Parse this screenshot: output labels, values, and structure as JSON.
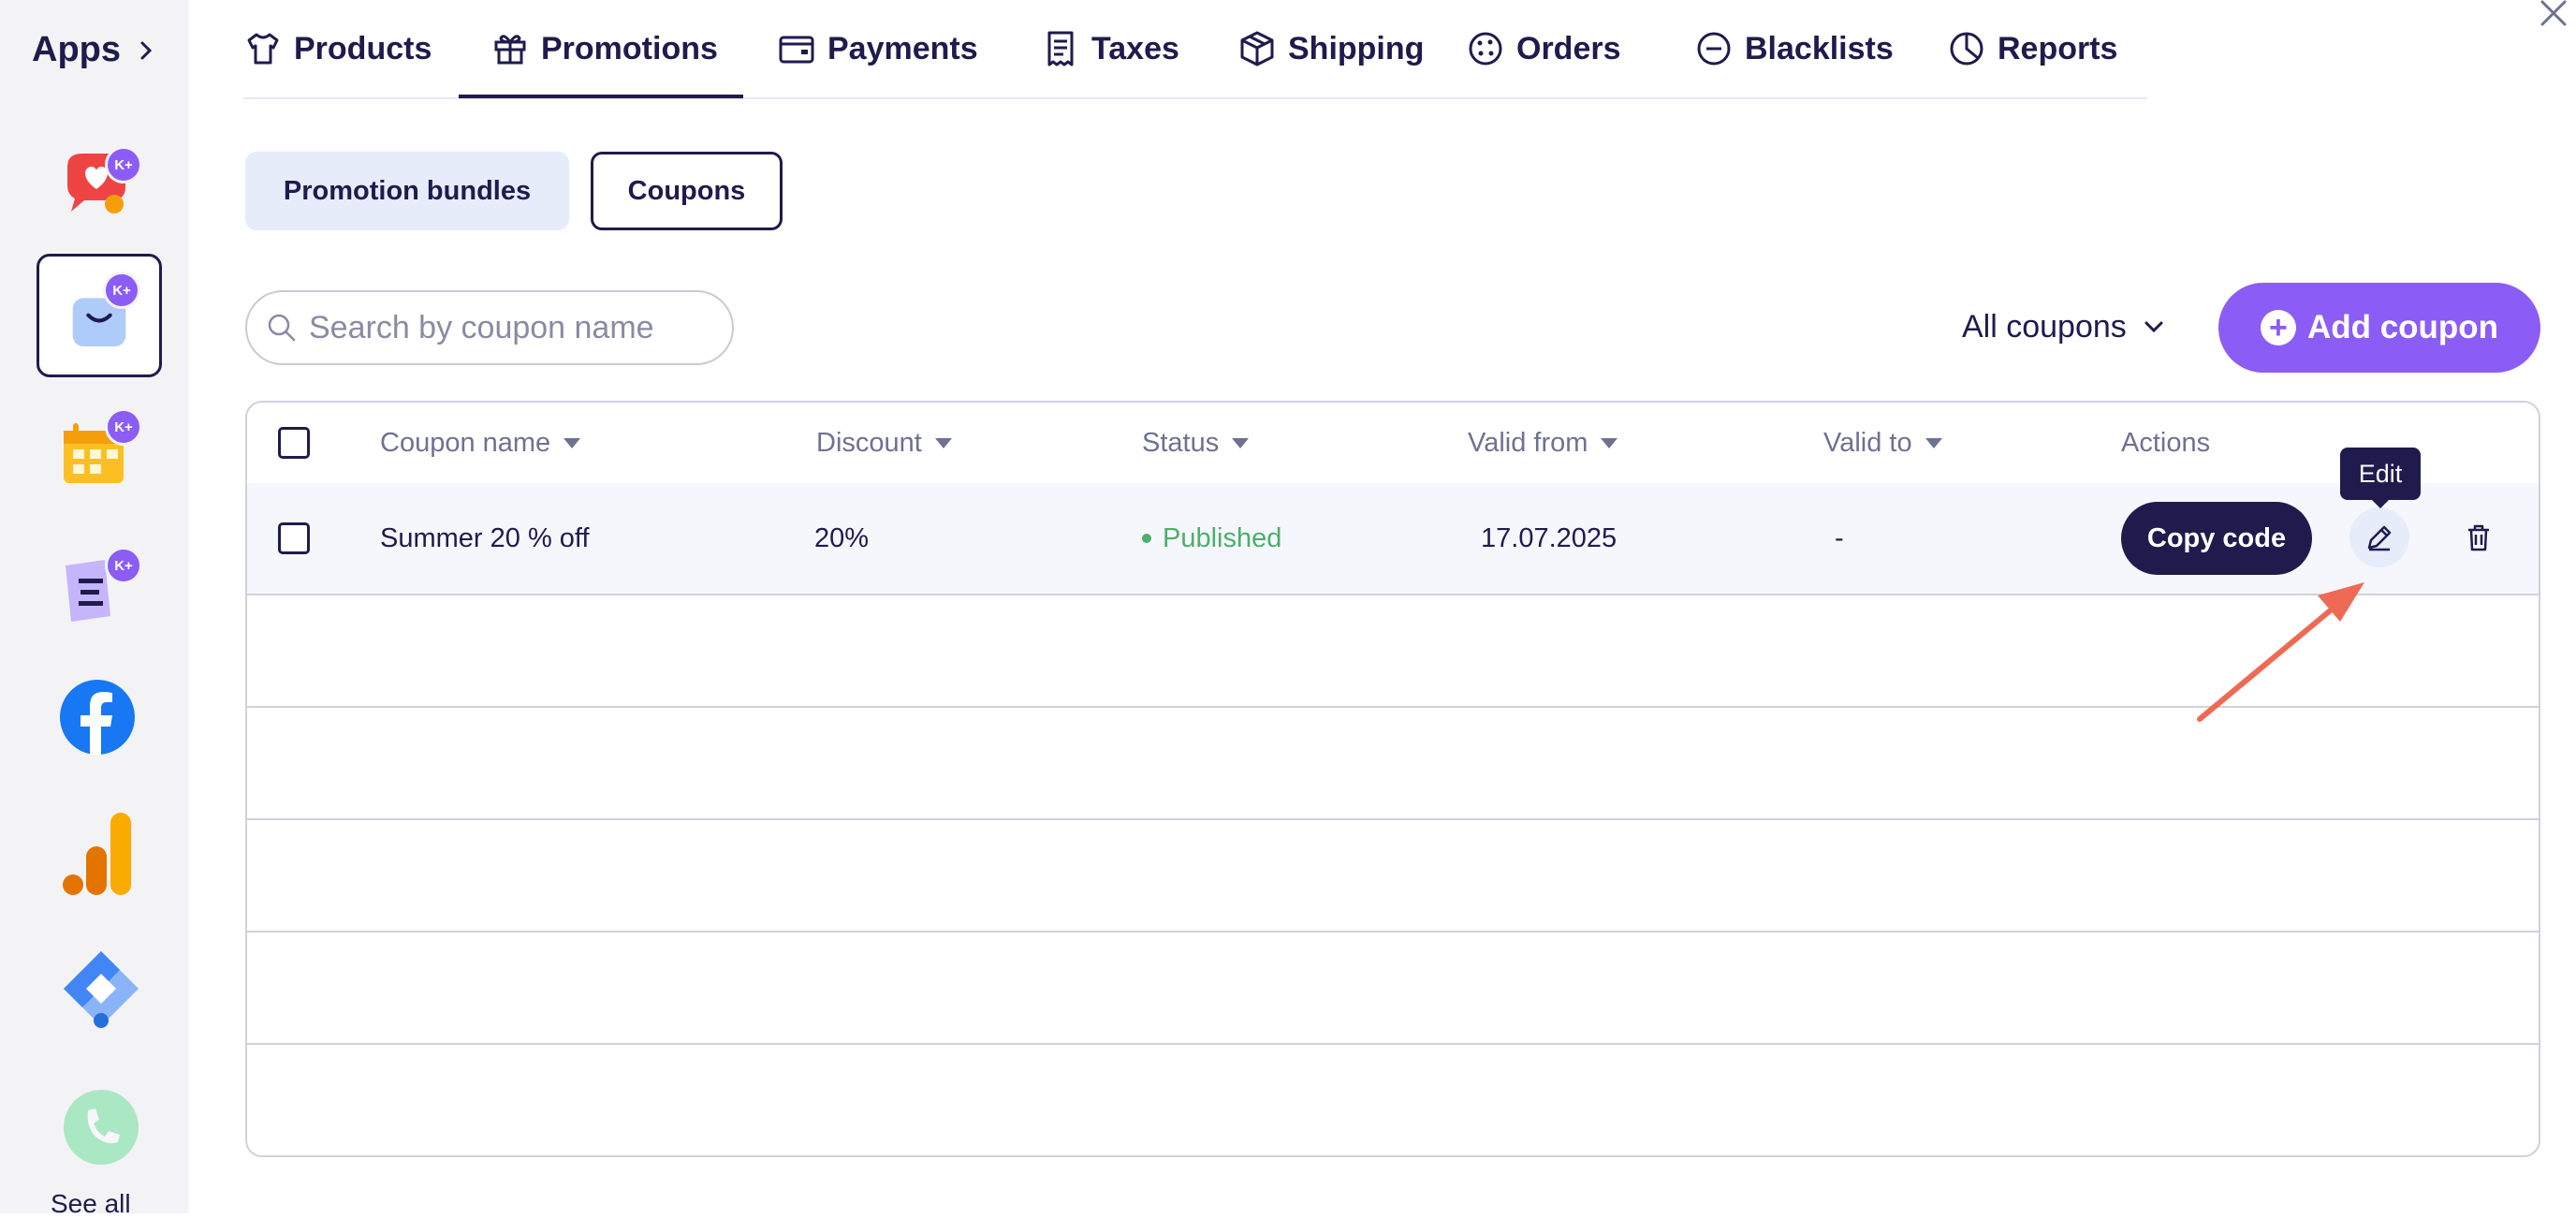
{
  "sidebar": {
    "title": "Apps",
    "see_all": "See all",
    "badge": "K+",
    "apps": [
      {
        "icon": "chat-heart-icon"
      },
      {
        "icon": "shopping-bag-icon"
      },
      {
        "icon": "calendar-icon"
      },
      {
        "icon": "document-list-icon"
      },
      {
        "icon": "facebook-icon"
      },
      {
        "icon": "analytics-bars-icon"
      },
      {
        "icon": "tag-manager-icon"
      },
      {
        "icon": "phone-icon"
      }
    ]
  },
  "tabs": [
    {
      "label": "Products",
      "icon": "tshirt-icon"
    },
    {
      "label": "Promotions",
      "icon": "gift-icon"
    },
    {
      "label": "Payments",
      "icon": "wallet-icon"
    },
    {
      "label": "Taxes",
      "icon": "receipt-icon"
    },
    {
      "label": "Shipping",
      "icon": "box-icon"
    },
    {
      "label": "Orders",
      "icon": "cookie-icon"
    },
    {
      "label": "Blacklists",
      "icon": "minus-circle-icon"
    },
    {
      "label": "Reports",
      "icon": "pie-chart-icon"
    }
  ],
  "active_tab": "Promotions",
  "subtabs": {
    "bundles": "Promotion bundles",
    "coupons": "Coupons"
  },
  "search": {
    "placeholder": "Search by coupon name",
    "value": ""
  },
  "filter": {
    "label": "All coupons"
  },
  "add_button": {
    "label": "Add coupon"
  },
  "table": {
    "columns": [
      "Coupon name",
      "Discount",
      "Status",
      "Valid from",
      "Valid to",
      "Actions"
    ],
    "rows": [
      {
        "name": "Summer 20 % off",
        "discount": "20%",
        "status": "Published",
        "valid_from": "17.07.2025",
        "valid_to": "-"
      }
    ],
    "copy_label": "Copy code",
    "edit_tooltip": "Edit"
  },
  "colors": {
    "primary": "#1f1b4d",
    "accent": "#8b5cf6",
    "published": "#4caf6a",
    "annotation": "#ee6a55"
  }
}
